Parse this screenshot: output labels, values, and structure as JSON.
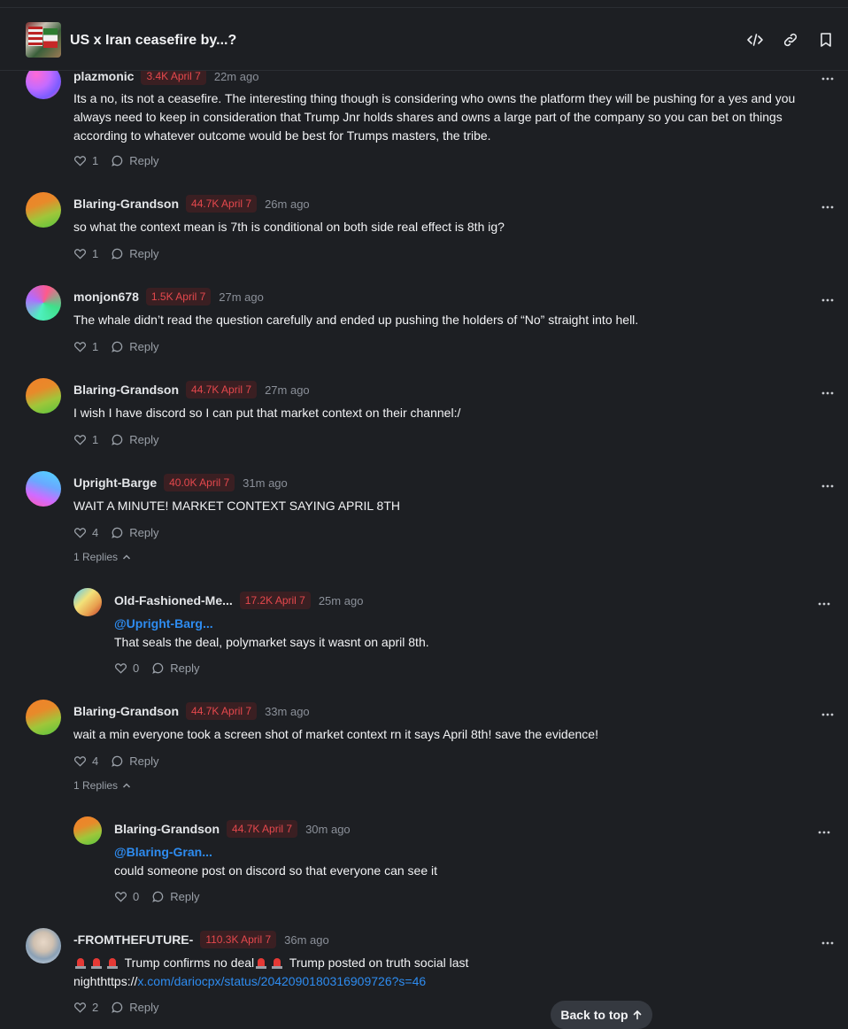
{
  "header": {
    "market_title": "US x Iran ceasefire by...?",
    "icons": [
      "embed-icon",
      "link-icon",
      "bookmark-icon"
    ]
  },
  "comments": [
    {
      "username": "plazmonic",
      "badge": "3.4K April 7",
      "time": "22m ago",
      "body": "Its a no, its not a ceasefire. The interesting thing though is considering who owns the platform they will be pushing for a yes and you always need to keep in consideration that Trump Jnr holds shares and owns a large part of the company so you can bet on things according to whatever outcome would be best for Trumps masters, the tribe.",
      "likes": "1",
      "reply_label": "Reply"
    },
    {
      "username": "Blaring-Grandson",
      "badge": "44.7K April 7",
      "time": "26m ago",
      "body": "so what the context mean is 7th is conditional on both side real effect is 8th ig?",
      "likes": "1",
      "reply_label": "Reply"
    },
    {
      "username": "monjon678",
      "badge": "1.5K April 7",
      "time": "27m ago",
      "body": "The whale didn’t read the question carefully and ended up pushing the holders of “No” straight into hell.",
      "likes": "1",
      "reply_label": "Reply"
    },
    {
      "username": "Blaring-Grandson",
      "badge": "44.7K April 7",
      "time": "27m ago",
      "body": "I wish I have discord so I can put that market context on their channel:/",
      "likes": "1",
      "reply_label": "Reply"
    },
    {
      "username": "Upright-Barge",
      "badge": "40.0K April 7",
      "time": "31m ago",
      "body": "WAIT A MINUTE! MARKET CONTEXT SAYING APRIL 8TH",
      "likes": "4",
      "reply_label": "Reply",
      "replies_toggle": "1 Replies",
      "reply": {
        "username": "Old-Fashioned-Me...",
        "badge": "17.2K April 7",
        "time": "25m ago",
        "mention": "@Upright-Barg...",
        "body": "That seals the deal, polymarket says it wasnt on april 8th.",
        "likes": "0",
        "reply_label": "Reply"
      }
    },
    {
      "username": "Blaring-Grandson",
      "badge": "44.7K April 7",
      "time": "33m ago",
      "body": "wait a min everyone took a screen shot of market context rn it says April 8th! save the evidence!",
      "likes": "4",
      "reply_label": "Reply",
      "replies_toggle": "1 Replies",
      "reply": {
        "username": "Blaring-Grandson",
        "badge": "44.7K April 7",
        "time": "30m ago",
        "mention": "@Blaring-Gran...",
        "body": "could someone post on discord so that everyone can see it",
        "likes": "0",
        "reply_label": "Reply"
      }
    },
    {
      "username": "-FROMTHEFUTURE-",
      "badge": "110.3K April 7",
      "time": "36m ago",
      "body_part1": " Trump confirms no deal",
      "body_part2": "  Trump posted on truth social last",
      "body_line2_prefix": "nighthttps://",
      "body_link": "x.com/dariocpx/status/2042090180316909726?s=46",
      "likes": "2",
      "reply_label": "Reply"
    }
  ],
  "back_to_top": "Back to top",
  "colors": {
    "background": "#1d1f23",
    "badge_text": "#e5484d",
    "badge_bg": "#3a1f22",
    "link": "#2e8cf0"
  }
}
